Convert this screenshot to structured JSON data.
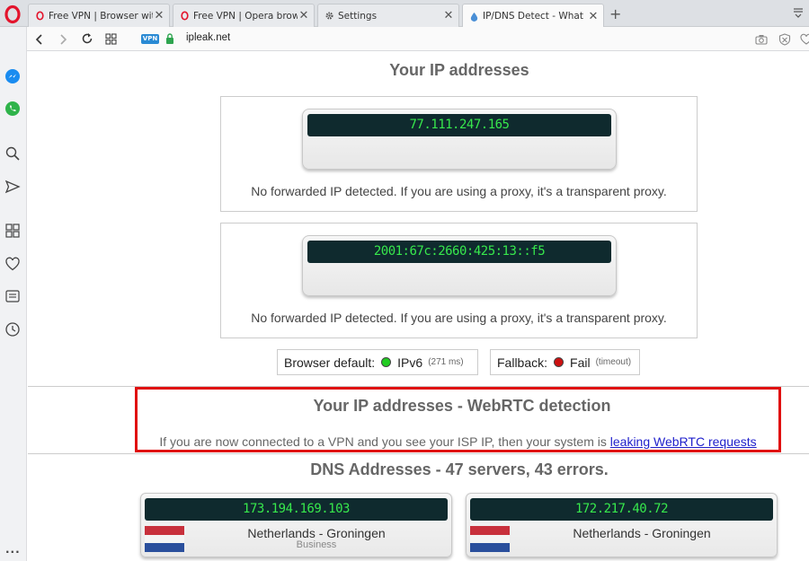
{
  "browser": {
    "tabs": [
      {
        "label": "Free VPN | Browser with bu",
        "icon": "opera-icon"
      },
      {
        "label": "Free VPN | Opera browser",
        "icon": "opera-icon"
      },
      {
        "label": "Settings",
        "icon": "gear-icon"
      },
      {
        "label": "IP/DNS Detect - What is yo",
        "icon": "ipleak-icon"
      }
    ],
    "new_tab": "+",
    "vpn_badge": "VPN",
    "url": "ipleak.net"
  },
  "page": {
    "ip_title": "Your IP addresses",
    "ipv4": "77.111.247.165",
    "ipv4_note": "No forwarded IP detected. If you are using a proxy, it's a transparent proxy.",
    "ipv6": "2001:67c:2660:425:13::f5",
    "ipv6_note": "No forwarded IP detected. If you are using a proxy, it's a transparent proxy.",
    "browser_default_label": "Browser default:",
    "browser_default_value": "IPv6",
    "browser_default_time": "(271 ms)",
    "fallback_label": "Fallback:",
    "fallback_value": "Fail",
    "fallback_detail": "(timeout)",
    "webrtc_title": "Your IP addresses - WebRTC detection",
    "webrtc_note": "If you are now connected to a VPN and you see your ISP IP, then your system is ",
    "webrtc_link": "leaking WebRTC requests",
    "dns_title": "DNS Addresses - 47 servers, 43 errors.",
    "dns_servers": [
      {
        "ip": "173.194.169.103",
        "location": "Netherlands - Groningen",
        "isp": "Business"
      },
      {
        "ip": "172.217.40.72",
        "location": "Netherlands - Groningen",
        "isp": ""
      }
    ]
  },
  "colors": {
    "lcd_text": "#37e84c",
    "lcd_bg": "#0f2a2e",
    "highlight_border": "#e01010",
    "status_ok": "#22cc22",
    "status_fail": "#cc1111"
  }
}
